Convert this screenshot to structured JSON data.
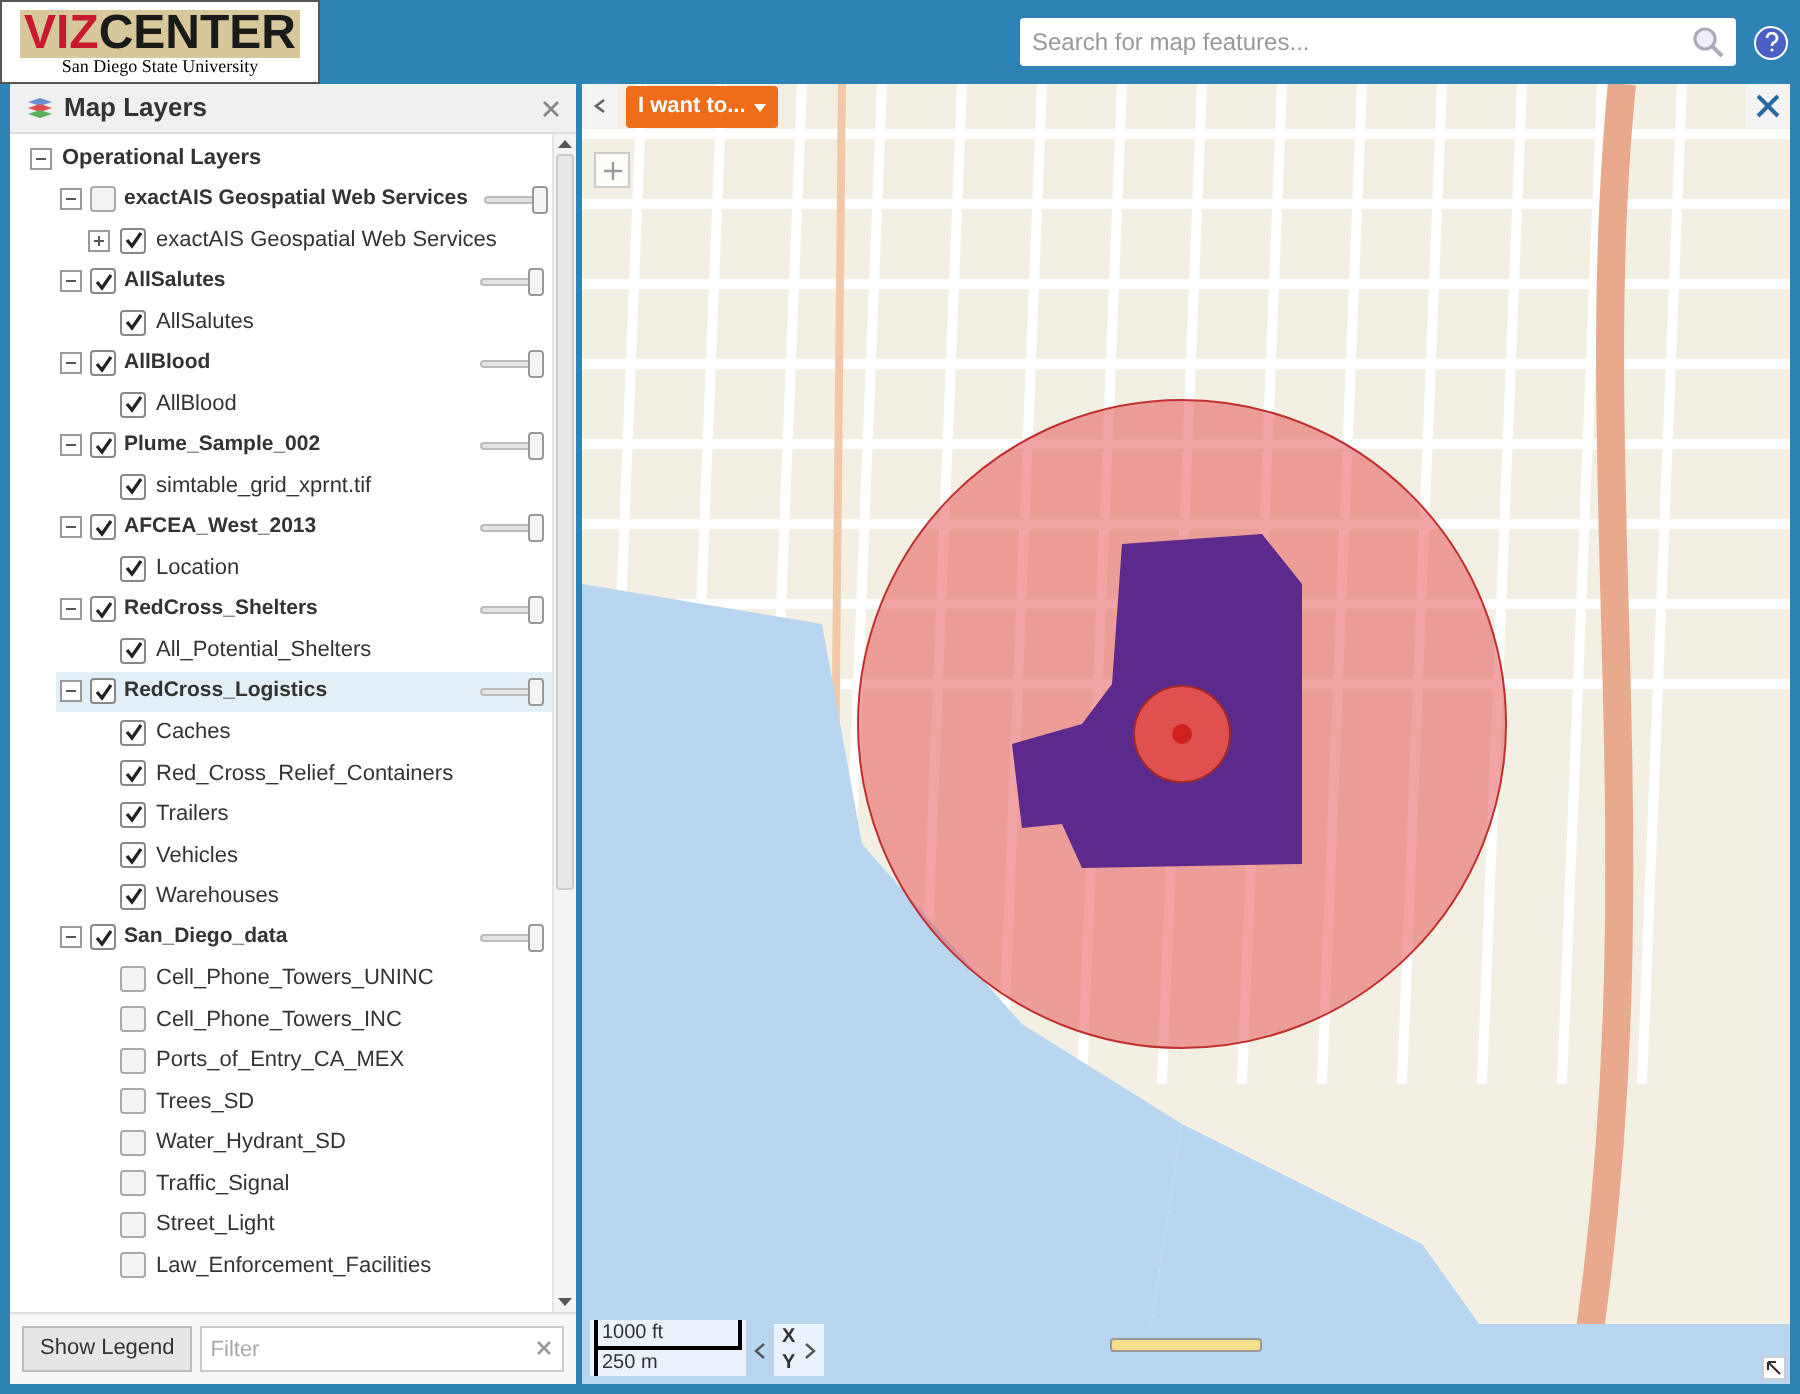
{
  "header": {
    "logo": {
      "part_1": "VIZ",
      "part_2": "CENTER",
      "subtitle": "San Diego State University"
    },
    "search": {
      "placeholder": "Search for map features..."
    }
  },
  "layers_panel": {
    "title": "Map Layers",
    "tree": {
      "label": "Operational Layers",
      "expanded": true,
      "children": [
        {
          "label": "exactAIS Geospatial Web Services",
          "checked": false,
          "expanded": true,
          "selected": false,
          "level": 1,
          "children": [
            {
              "label": "exactAIS Geospatial Web Services",
              "checked": true,
              "expanded": false
            }
          ]
        },
        {
          "label": "AllSalutes",
          "checked": true,
          "expanded": true,
          "selected": false,
          "level": 1,
          "children": [
            {
              "label": "AllSalutes",
              "checked": true
            }
          ]
        },
        {
          "label": "AllBlood",
          "checked": true,
          "expanded": true,
          "selected": false,
          "level": 1,
          "children": [
            {
              "label": "AllBlood",
              "checked": true
            }
          ]
        },
        {
          "label": "Plume_Sample_002",
          "checked": true,
          "expanded": true,
          "selected": false,
          "level": 1,
          "children": [
            {
              "label": "simtable_grid_xprnt.tif",
              "checked": true
            }
          ]
        },
        {
          "label": "AFCEA_West_2013",
          "checked": true,
          "expanded": true,
          "selected": false,
          "level": 1,
          "children": [
            {
              "label": "Location",
              "checked": true
            }
          ]
        },
        {
          "label": "RedCross_Shelters",
          "checked": true,
          "expanded": true,
          "selected": false,
          "level": 1,
          "children": [
            {
              "label": "All_Potential_Shelters",
              "checked": true
            }
          ]
        },
        {
          "label": "RedCross_Logistics",
          "checked": true,
          "expanded": true,
          "selected": true,
          "level": 1,
          "children": [
            {
              "label": "Caches",
              "checked": true
            },
            {
              "label": "Red_Cross_Relief_Containers",
              "checked": true
            },
            {
              "label": "Trailers",
              "checked": true
            },
            {
              "label": "Vehicles",
              "checked": true
            },
            {
              "label": "Warehouses",
              "checked": true
            }
          ]
        },
        {
          "label": "San_Diego_data",
          "checked": true,
          "expanded": true,
          "selected": false,
          "level": 1,
          "children": [
            {
              "label": "Cell_Phone_Towers_UNINC",
              "checked": false
            },
            {
              "label": "Cell_Phone_Towers_INC",
              "checked": false
            },
            {
              "label": "Ports_of_Entry_CA_MEX",
              "checked": false
            },
            {
              "label": "Trees_SD",
              "checked": false
            },
            {
              "label": "Water_Hydrant_SD",
              "checked": false
            },
            {
              "label": "Traffic_Signal",
              "checked": false
            },
            {
              "label": "Street_Light",
              "checked": false
            },
            {
              "label": "Law_Enforcement_Facilities",
              "checked": false
            }
          ]
        }
      ]
    },
    "footer": {
      "legend_button": "Show Legend",
      "filter": {
        "placeholder": "Filter"
      }
    }
  },
  "map": {
    "menu_button": "I want to...",
    "scale": {
      "imperial": "1000 ft",
      "metric": "250 m"
    },
    "coordinates": {
      "x": "X",
      "y": "Y"
    }
  }
}
